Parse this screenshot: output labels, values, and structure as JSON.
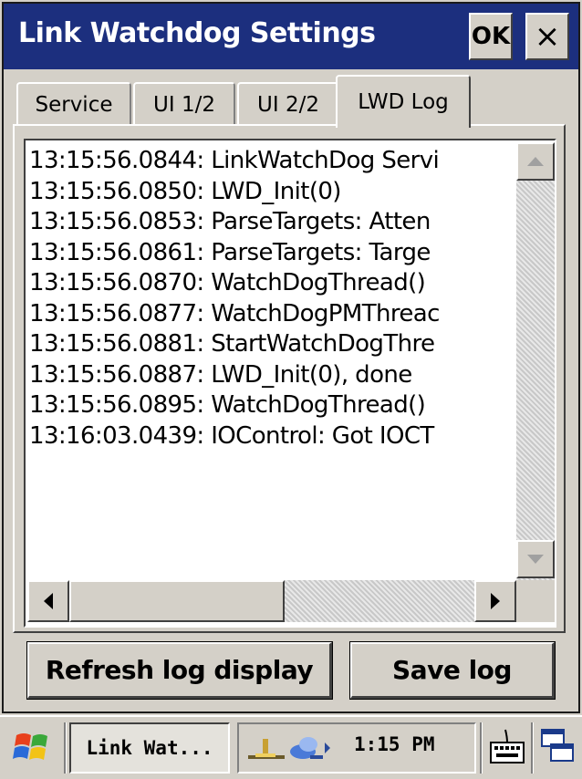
{
  "window": {
    "title": "Link Watchdog Settings",
    "ok_label": "OK",
    "close_label": "×"
  },
  "tabs": [
    {
      "label": "Service",
      "active": false
    },
    {
      "label": "UI 1/2",
      "active": false
    },
    {
      "label": "UI 2/2",
      "active": false
    },
    {
      "label": "LWD Log",
      "active": true
    }
  ],
  "log": {
    "lines": [
      "13:15:56.0844: LinkWatchDog Servi",
      "13:15:56.0850: LWD_Init(0)",
      "13:15:56.0853: ParseTargets: Atten",
      "13:15:56.0861: ParseTargets: Targe",
      "13:15:56.0870: WatchDogThread()",
      "13:15:56.0877: WatchDogPMThreac",
      "13:15:56.0881: StartWatchDogThre",
      "13:15:56.0887: LWD_Init(0), done",
      "13:15:56.0895: WatchDogThread()",
      "13:16:03.0439: IOControl: Got IOCT"
    ]
  },
  "buttons": {
    "refresh_label": "Refresh log display",
    "save_label": "Save log"
  },
  "taskbar": {
    "task_label": "Link Wat...",
    "clock": "1:15 PM",
    "icons": [
      "windows-start-icon",
      "network-icon",
      "connection-icon",
      "keyboard-icon",
      "windows-switch-icon"
    ]
  },
  "colors": {
    "titlebar": "#1c2f7e",
    "face": "#d4d0c8"
  }
}
